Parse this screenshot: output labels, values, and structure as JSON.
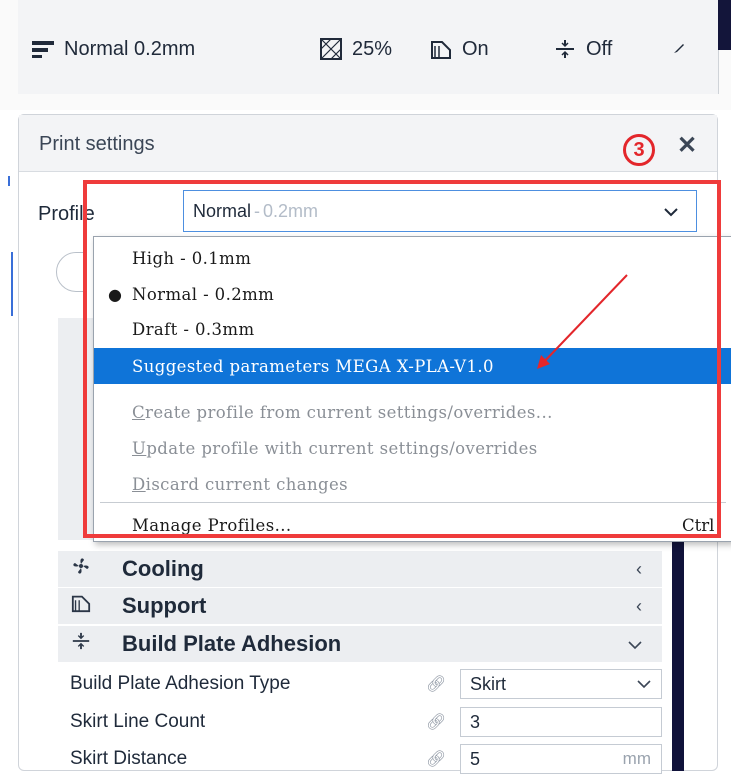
{
  "toolbar": {
    "profile_label": "Normal 0.2mm",
    "infill_label": "25%",
    "support_label": "On",
    "adhesion_label": "Off"
  },
  "panel": {
    "title": "Print settings",
    "close_glyph": "✕",
    "step_marker": "3"
  },
  "profile": {
    "label": "Profile",
    "selected_name": "Normal",
    "selected_sep": "-",
    "selected_layer": "0.2mm"
  },
  "menu": {
    "items": [
      {
        "label": "High - 0.1mm"
      },
      {
        "label": "Normal - 0.2mm",
        "checked": true
      },
      {
        "label": "Draft - 0.3mm"
      },
      {
        "label": "Suggested parameters MEGA X-PLA-V1.0",
        "selected": true
      },
      {
        "label_first": "C",
        "label_rest": "reate profile from current settings/overrides...",
        "disabled": true
      },
      {
        "label_first": "U",
        "label_rest": "pdate profile with current settings/overrides",
        "disabled": true
      },
      {
        "label_first": "D",
        "label_rest": "iscard current changes",
        "disabled": true
      },
      {
        "label": "Manage Profiles...",
        "shortcut": "Ctrl"
      }
    ]
  },
  "categories": [
    {
      "label": "Cooling",
      "icon": "fan-icon",
      "chevron": "‹"
    },
    {
      "label": "Support",
      "icon": "support-icon",
      "chevron": "‹"
    },
    {
      "label": "Build Plate Adhesion",
      "icon": "adhesion-icon",
      "chevron": "⌄"
    }
  ],
  "settings": [
    {
      "label": "Build Plate Adhesion Type",
      "value": "Skirt",
      "has_dropdown": true
    },
    {
      "label": "Skirt Line Count",
      "value": "3"
    },
    {
      "label": "Skirt Distance",
      "value": "5",
      "unit": "mm"
    }
  ],
  "colors": {
    "accent": "#0f74d8",
    "annotation": "#ef3b3b"
  }
}
